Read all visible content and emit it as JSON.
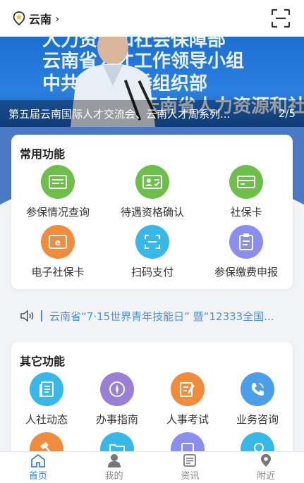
{
  "header": {
    "city": "云南",
    "chevron": "›",
    "scan_icon": "scan-frame-icon"
  },
  "banner": {
    "background_lines": [
      "人力资源和社会保障部",
      "云南省人才工作领导小组",
      "中共云南省委组织部",
      "云南省人力资源和社会保障厅"
    ],
    "caption": "第五届云南国际人才交流会、云南人才周系列...",
    "pager": "2/5"
  },
  "common": {
    "title": "常用功能",
    "items": [
      {
        "label": "参保情况查询",
        "color": "#6cc04a",
        "icon": "insurance-query-icon"
      },
      {
        "label": "待遇资格确认",
        "color": "#6cc04a",
        "icon": "qualification-card-icon"
      },
      {
        "label": "社保卡",
        "color": "#6cc04a",
        "icon": "card-icon"
      },
      {
        "label": "电子社保卡",
        "color": "#f08c3c",
        "icon": "e-card-icon"
      },
      {
        "label": "扫码支付",
        "color": "#36b8e8",
        "icon": "scan-pay-icon"
      },
      {
        "label": "参保缴费申报",
        "color": "#8a8ef0",
        "icon": "clipboard-icon"
      }
    ]
  },
  "notice": {
    "icon": "speaker-icon",
    "text": "云南省“7·15世界青年技能日” 暨“12333全国..."
  },
  "other": {
    "title": "其它功能",
    "items": [
      {
        "label": "人社动态",
        "color": "#36b8e8",
        "icon": "news-icon"
      },
      {
        "label": "办事指南",
        "color": "#9a7fd8",
        "icon": "compass-icon"
      },
      {
        "label": "人事考试",
        "color": "#f08c3c",
        "icon": "exam-edit-icon"
      },
      {
        "label": "业务咨询",
        "color": "#4a9fe8",
        "icon": "phone-icon"
      }
    ],
    "partial_colors": [
      "#f08c3c",
      "#36b8e8",
      "#8a8ef0",
      "#36b8e8"
    ]
  },
  "tabs": [
    {
      "label": "首页",
      "icon": "home-icon",
      "active": true
    },
    {
      "label": "我的",
      "icon": "user-icon",
      "active": false
    },
    {
      "label": "资讯",
      "icon": "news-list-icon",
      "active": false
    },
    {
      "label": "附近",
      "icon": "location-pin-icon",
      "active": false
    }
  ]
}
